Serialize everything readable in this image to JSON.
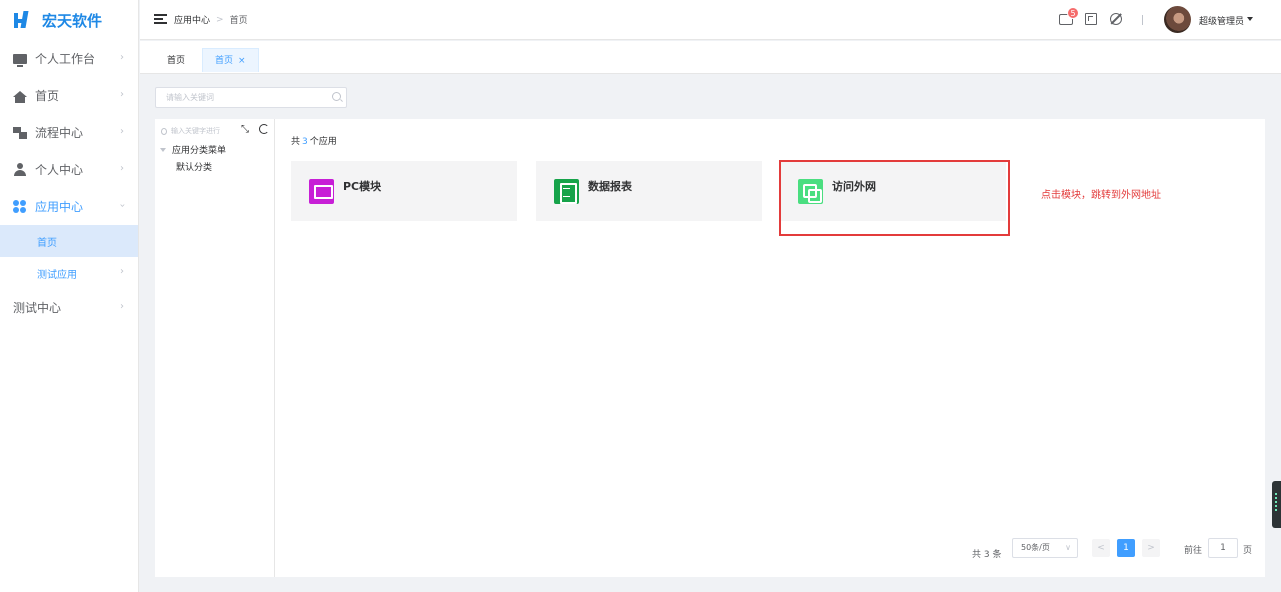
{
  "app": {
    "logo_text": "宏天软件",
    "accent": "#409eff",
    "brand": "#1e88e5"
  },
  "sidebar": {
    "items": [
      {
        "label": "个人工作台",
        "icon": "monitor-icon"
      },
      {
        "label": "首页",
        "icon": "home-icon"
      },
      {
        "label": "流程中心",
        "icon": "flow-icon"
      },
      {
        "label": "个人中心",
        "icon": "user-icon"
      },
      {
        "label": "应用中心",
        "icon": "apps-icon",
        "expanded": true
      },
      {
        "label": "测试中心"
      }
    ],
    "sub_items": [
      {
        "label": "首页",
        "active": true
      },
      {
        "label": "测试应用"
      }
    ]
  },
  "header": {
    "breadcrumb": [
      "应用中心",
      "首页"
    ],
    "breadcrumb_sep": ">",
    "badge_count": "5",
    "user_name": "超级管理员"
  },
  "tabs": [
    {
      "label": "首页"
    },
    {
      "label": "首页",
      "active": true,
      "close": "×"
    }
  ],
  "search": {
    "placeholder": "请输入关键词"
  },
  "tree": {
    "search_placeholder": "输入关键字进行",
    "root": "应用分类菜单",
    "child": "默认分类"
  },
  "main": {
    "count_prefix": "共",
    "count": "3",
    "count_suffix": "个应用",
    "cards": [
      {
        "title": "PC模块",
        "icon": "monitor-icon",
        "color": "#c71fd6"
      },
      {
        "title": "数据报表",
        "icon": "report-icon",
        "color": "#16a34a"
      },
      {
        "title": "访问外网",
        "icon": "external-link-icon",
        "color": "#4ade80"
      }
    ],
    "annotation": "点击模块，跳转到外网地址"
  },
  "pagination": {
    "total": "共 3 条",
    "page_size": "50条/页",
    "prev": "<",
    "current": "1",
    "next": ">",
    "goto_prefix": "前往",
    "goto_value": "1",
    "goto_suffix": "页"
  }
}
